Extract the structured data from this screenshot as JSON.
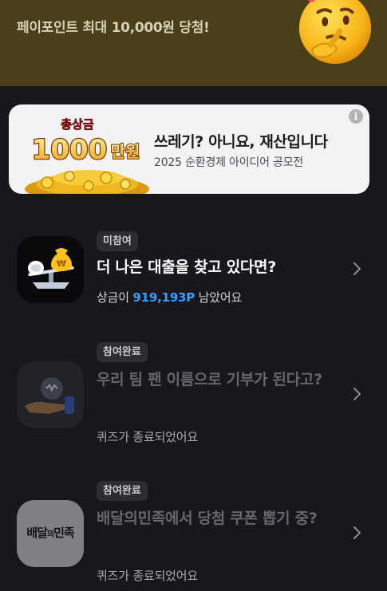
{
  "top_banner": {
    "title": "페이포인트 최대 10,000원 당첨!"
  },
  "ad": {
    "art_line1": "총상금",
    "art_amount": "1000",
    "art_unit": "만원",
    "title": "쓰레기? 아니요, 재산입니다",
    "subtitle": "2025 순환경제 아이디어 공모전",
    "info_label": "i"
  },
  "items": [
    {
      "badge": "미참여",
      "title": "더 나은 대출을 찾고 있다면?",
      "sub_prefix": "상금이 ",
      "sub_points": "919,193P",
      "sub_suffix": " 남았어요"
    },
    {
      "badge": "참여완료",
      "title": "우리 팀 팬 이름으로 기부가 된다고?",
      "sub": "퀴즈가 종료되었어요"
    },
    {
      "badge": "참여완료",
      "title": "배달의민족에서 당첨 쿠폰 뽑기 중?",
      "sub": "퀴즈가 종료되었어요",
      "logo_text_a": "배달",
      "logo_text_b": "의",
      "logo_text_c": "민족"
    }
  ],
  "colors": {
    "accent_points": "#3f9bff",
    "banner_bg": "#4a3f18",
    "page_bg": "#17171c"
  },
  "icons": [
    "thinking-face-icon",
    "info-icon",
    "chevron-right-icon",
    "money-bag-icon",
    "donation-hand-icon"
  ]
}
